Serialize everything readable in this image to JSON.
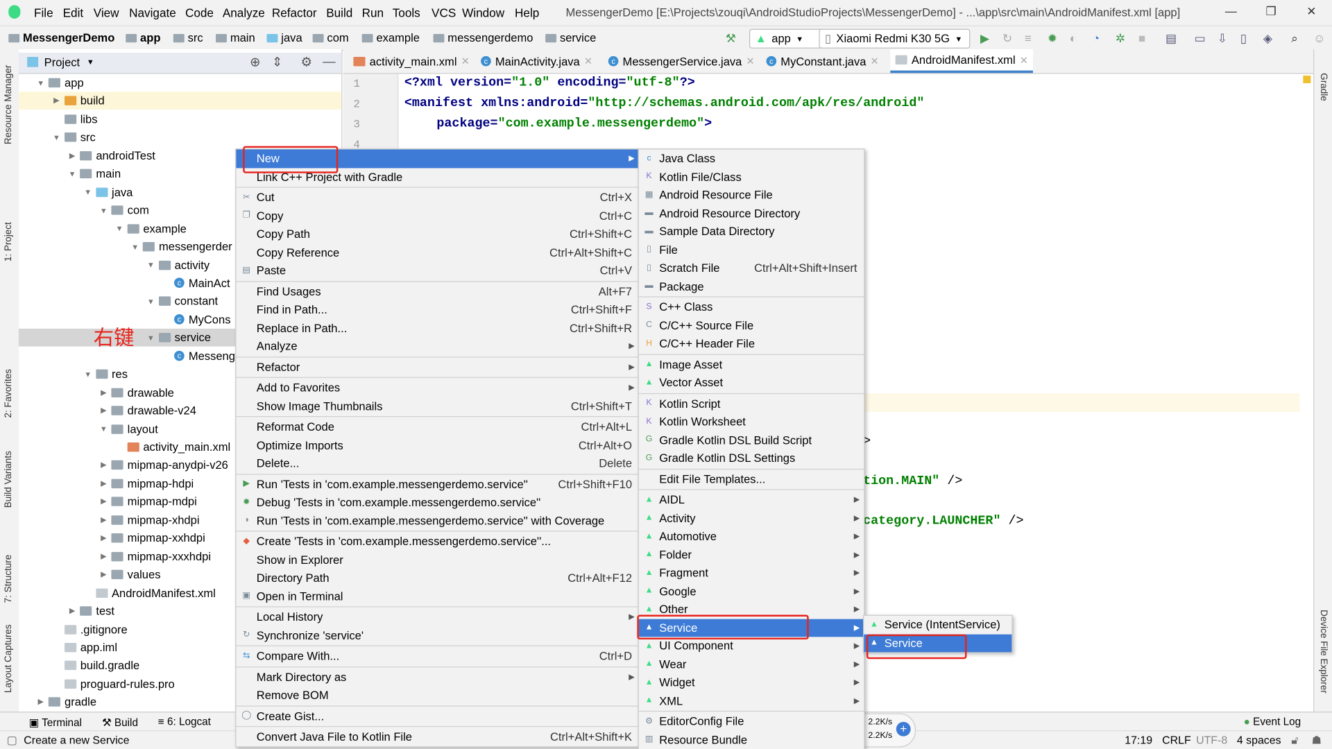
{
  "window": {
    "title": "MessengerDemo [E:\\Projects\\zouqi\\AndroidStudioProjects\\MessengerDemo] - ...\\app\\src\\main\\AndroidManifest.xml [app]",
    "minimize": "—",
    "restore": "❐",
    "close": "✕"
  },
  "menubar": [
    "File",
    "Edit",
    "View",
    "Navigate",
    "Code",
    "Analyze",
    "Refactor",
    "Build",
    "Run",
    "Tools",
    "VCS",
    "Window",
    "Help"
  ],
  "breadcrumb": [
    "MessengerDemo",
    "app",
    "src",
    "main",
    "java",
    "com",
    "example",
    "messengerdemo",
    "service"
  ],
  "toolbar": {
    "run_config": "app",
    "device": "Xiaomi Redmi K30 5G"
  },
  "left_strip": [
    "Resource Manager",
    "1: Project",
    "2: Favorites",
    "Build Variants",
    "7: Structure",
    "Layout Captures"
  ],
  "right_strip": [
    "Gradle",
    "Device File Explorer"
  ],
  "project_panel": {
    "title": "Project",
    "tree": [
      {
        "label": "app",
        "level": 0,
        "state": "open",
        "icon": "folder"
      },
      {
        "label": "build",
        "level": 1,
        "state": "closed",
        "icon": "folder-orange",
        "highlight": true
      },
      {
        "label": "libs",
        "level": 1,
        "state": "none",
        "icon": "folder"
      },
      {
        "label": "src",
        "level": 1,
        "state": "open",
        "icon": "folder"
      },
      {
        "label": "androidTest",
        "level": 2,
        "state": "closed",
        "icon": "folder"
      },
      {
        "label": "main",
        "level": 2,
        "state": "open",
        "icon": "folder"
      },
      {
        "label": "java",
        "level": 3,
        "state": "open",
        "icon": "folder-blue"
      },
      {
        "label": "com",
        "level": 4,
        "state": "open",
        "icon": "package"
      },
      {
        "label": "example",
        "level": 5,
        "state": "open",
        "icon": "package"
      },
      {
        "label": "messengerder",
        "level": 6,
        "state": "open",
        "icon": "package"
      },
      {
        "label": "activity",
        "level": 7,
        "state": "open",
        "icon": "package"
      },
      {
        "label": "MainAct",
        "level": 8,
        "state": "none",
        "icon": "class"
      },
      {
        "label": "constant",
        "level": 7,
        "state": "open",
        "icon": "package"
      },
      {
        "label": "MyCons",
        "level": 8,
        "state": "none",
        "icon": "class"
      },
      {
        "label": "service",
        "level": 7,
        "state": "open",
        "icon": "package",
        "selected": true
      },
      {
        "label": "Messeng",
        "level": 8,
        "state": "none",
        "icon": "class"
      },
      {
        "label": "res",
        "level": 3,
        "state": "open",
        "icon": "folder"
      },
      {
        "label": "drawable",
        "level": 4,
        "state": "closed",
        "icon": "folder"
      },
      {
        "label": "drawable-v24",
        "level": 4,
        "state": "closed",
        "icon": "folder"
      },
      {
        "label": "layout",
        "level": 4,
        "state": "open",
        "icon": "folder"
      },
      {
        "label": "activity_main.xml",
        "level": 5,
        "state": "none",
        "icon": "xml"
      },
      {
        "label": "mipmap-anydpi-v26",
        "level": 4,
        "state": "closed",
        "icon": "folder"
      },
      {
        "label": "mipmap-hdpi",
        "level": 4,
        "state": "closed",
        "icon": "folder"
      },
      {
        "label": "mipmap-mdpi",
        "level": 4,
        "state": "closed",
        "icon": "folder"
      },
      {
        "label": "mipmap-xhdpi",
        "level": 4,
        "state": "closed",
        "icon": "folder"
      },
      {
        "label": "mipmap-xxhdpi",
        "level": 4,
        "state": "closed",
        "icon": "folder"
      },
      {
        "label": "mipmap-xxxhdpi",
        "level": 4,
        "state": "closed",
        "icon": "folder"
      },
      {
        "label": "values",
        "level": 4,
        "state": "closed",
        "icon": "folder"
      },
      {
        "label": "AndroidManifest.xml",
        "level": 3,
        "state": "none",
        "icon": "manifest"
      },
      {
        "label": "test",
        "level": 2,
        "state": "closed",
        "icon": "folder"
      },
      {
        "label": ".gitignore",
        "level": 1,
        "state": "none",
        "icon": "file"
      },
      {
        "label": "app.iml",
        "level": 1,
        "state": "none",
        "icon": "file"
      },
      {
        "label": "build.gradle",
        "level": 1,
        "state": "none",
        "icon": "file"
      },
      {
        "label": "proguard-rules.pro",
        "level": 1,
        "state": "none",
        "icon": "file"
      },
      {
        "label": "gradle",
        "level": 0,
        "state": "closed",
        "icon": "folder"
      }
    ]
  },
  "annotation": {
    "right_click": "右键",
    "color": "#e8231c"
  },
  "tabs": [
    {
      "label": "activity_main.xml",
      "icon": "xml"
    },
    {
      "label": "MainActivity.java",
      "icon": "class"
    },
    {
      "label": "MessengerService.java",
      "icon": "class"
    },
    {
      "label": "MyConstant.java",
      "icon": "class"
    },
    {
      "label": "AndroidManifest.xml",
      "icon": "manifest",
      "active": true
    }
  ],
  "editor": {
    "line_numbers": [
      "1",
      "2",
      "3",
      "4"
    ],
    "line1": {
      "a": "<?xml ",
      "b": "version=",
      "c": "\"1.0\"",
      "d": " encoding=",
      "e": "\"utf-8\"",
      "f": "?>"
    },
    "line2": {
      "a": "<manifest ",
      "b": "xmlns:android=",
      "c": "\"http://schemas.android.com/apk/res/android\""
    },
    "line3": {
      "b": "package=",
      "c": "\"com.example.messengerdemo\"",
      "f": ">"
    },
    "frag1": ">",
    "frag2": {
      "s": "tion.MAIN\"",
      "p": " />"
    },
    "frag3": {
      "s": "category.LAUNCHER\"",
      "p": " />"
    }
  },
  "context_menu": [
    {
      "label": "New",
      "sub": true,
      "selected": true
    },
    {
      "label": "Link C++ Project with Gradle"
    },
    {
      "sep": true
    },
    {
      "label": "Cut",
      "shortcut": "Ctrl+X",
      "icon": "cut-icon"
    },
    {
      "label": "Copy",
      "shortcut": "Ctrl+C",
      "icon": "copy-icon"
    },
    {
      "label": "Copy Path",
      "shortcut": "Ctrl+Shift+C"
    },
    {
      "label": "Copy Reference",
      "shortcut": "Ctrl+Alt+Shift+C"
    },
    {
      "label": "Paste",
      "shortcut": "Ctrl+V",
      "icon": "paste-icon"
    },
    {
      "sep": true
    },
    {
      "label": "Find Usages",
      "shortcut": "Alt+F7"
    },
    {
      "label": "Find in Path...",
      "shortcut": "Ctrl+Shift+F"
    },
    {
      "label": "Replace in Path...",
      "shortcut": "Ctrl+Shift+R"
    },
    {
      "label": "Analyze",
      "sub": true
    },
    {
      "sep": true
    },
    {
      "label": "Refactor",
      "sub": true
    },
    {
      "sep": true
    },
    {
      "label": "Add to Favorites",
      "sub": true
    },
    {
      "label": "Show Image Thumbnails",
      "shortcut": "Ctrl+Shift+T"
    },
    {
      "sep": true
    },
    {
      "label": "Reformat Code",
      "shortcut": "Ctrl+Alt+L"
    },
    {
      "label": "Optimize Imports",
      "shortcut": "Ctrl+Alt+O"
    },
    {
      "label": "Delete...",
      "shortcut": "Delete"
    },
    {
      "sep": true
    },
    {
      "label": "Run 'Tests in 'com.example.messengerdemo.service''",
      "shortcut": "Ctrl+Shift+F10",
      "icon": "run-icon"
    },
    {
      "label": "Debug 'Tests in 'com.example.messengerdemo.service''",
      "icon": "debug-icon"
    },
    {
      "label": "Run 'Tests in 'com.example.messengerdemo.service'' with Coverage",
      "icon": "coverage-icon"
    },
    {
      "sep": true
    },
    {
      "label": "Create 'Tests in 'com.example.messengerdemo.service''...",
      "icon": "create-test-icon"
    },
    {
      "label": "Show in Explorer"
    },
    {
      "label": "Directory Path",
      "shortcut": "Ctrl+Alt+F12"
    },
    {
      "label": "Open in Terminal",
      "icon": "terminal-icon"
    },
    {
      "sep": true
    },
    {
      "label": "Local History",
      "sub": true
    },
    {
      "label": "Synchronize 'service'",
      "icon": "sync-icon"
    },
    {
      "sep": true
    },
    {
      "label": "Compare With...",
      "shortcut": "Ctrl+D",
      "icon": "compare-icon"
    },
    {
      "sep": true
    },
    {
      "label": "Mark Directory as",
      "sub": true
    },
    {
      "label": "Remove BOM"
    },
    {
      "sep": true
    },
    {
      "label": "Create Gist...",
      "icon": "github-icon"
    },
    {
      "sep": true
    },
    {
      "label": "Convert Java File to Kotlin File",
      "shortcut": "Ctrl+Alt+Shift+K"
    }
  ],
  "new_menu": [
    {
      "label": "Java Class",
      "icon": "class-icon"
    },
    {
      "label": "Kotlin File/Class",
      "icon": "kotlin-icon"
    },
    {
      "label": "Android Resource File",
      "icon": "resource-file-icon"
    },
    {
      "label": "Android Resource Directory",
      "icon": "folder-icon"
    },
    {
      "label": "Sample Data Directory",
      "icon": "folder-icon"
    },
    {
      "label": "File",
      "icon": "file-icon"
    },
    {
      "label": "Scratch File",
      "shortcut": "Ctrl+Alt+Shift+Insert",
      "icon": "scratch-icon"
    },
    {
      "label": "Package",
      "icon": "package-icon"
    },
    {
      "sep": true
    },
    {
      "label": "C++ Class",
      "icon": "cpp-class-icon"
    },
    {
      "label": "C/C++ Source File",
      "icon": "cpp-source-icon"
    },
    {
      "label": "C/C++ Header File",
      "icon": "cpp-header-icon"
    },
    {
      "sep": true
    },
    {
      "label": "Image Asset",
      "icon": "android-icon"
    },
    {
      "label": "Vector Asset",
      "icon": "android-icon"
    },
    {
      "sep": true
    },
    {
      "label": "Kotlin Script",
      "icon": "kotlin-icon"
    },
    {
      "label": "Kotlin Worksheet",
      "icon": "kotlin-icon"
    },
    {
      "label": "Gradle Kotlin DSL Build Script",
      "icon": "gradle-icon"
    },
    {
      "label": "Gradle Kotlin DSL Settings",
      "icon": "gradle-icon"
    },
    {
      "sep": true
    },
    {
      "label": "Edit File Templates..."
    },
    {
      "sep": true
    },
    {
      "label": "AIDL",
      "sub": true,
      "icon": "android-icon"
    },
    {
      "label": "Activity",
      "sub": true,
      "icon": "android-icon"
    },
    {
      "label": "Automotive",
      "sub": true,
      "icon": "android-icon"
    },
    {
      "label": "Folder",
      "sub": true,
      "icon": "android-icon"
    },
    {
      "label": "Fragment",
      "sub": true,
      "icon": "android-icon"
    },
    {
      "label": "Google",
      "sub": true,
      "icon": "android-icon"
    },
    {
      "label": "Other",
      "sub": true,
      "icon": "android-icon"
    },
    {
      "label": "Service",
      "sub": true,
      "icon": "android-icon",
      "selected": true
    },
    {
      "label": "UI Component",
      "sub": true,
      "icon": "android-icon"
    },
    {
      "label": "Wear",
      "sub": true,
      "icon": "android-icon"
    },
    {
      "label": "Widget",
      "sub": true,
      "icon": "android-icon"
    },
    {
      "label": "XML",
      "sub": true,
      "icon": "android-icon"
    },
    {
      "sep": true
    },
    {
      "label": "EditorConfig File",
      "icon": "gear-icon"
    },
    {
      "label": "Resource Bundle",
      "icon": "bundle-icon"
    }
  ],
  "service_menu": [
    {
      "label": "Service (IntentService)",
      "icon": "android-file-icon"
    },
    {
      "label": "Service",
      "icon": "android-file-icon",
      "selected": true
    }
  ],
  "bottom_tools": [
    "Terminal",
    "Build",
    "6: Logcat",
    "Event Log"
  ],
  "network": {
    "up": "2.2K/s",
    "down": "2.2K/s"
  },
  "status": {
    "message": "Create a new Service",
    "position": "17:19",
    "line_sep": "CRLF",
    "encoding": "UTF-8",
    "indent": "4 spaces"
  },
  "colors": {
    "accent": "#3d7bd6",
    "highlight_annotation": "#e8231c"
  }
}
